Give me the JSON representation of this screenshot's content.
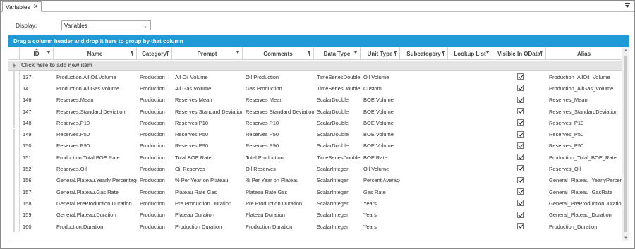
{
  "tab": {
    "title": "Variables",
    "close_glyph": "✕"
  },
  "display": {
    "label": "Display:",
    "value": "Variables"
  },
  "grid": {
    "group_panel": "Drag a column header and drop it here to group by that column",
    "add_row": "Click here to add new item",
    "columns": [
      "ID",
      "Name",
      "Category",
      "Prompt",
      "Comments",
      "Data Type",
      "Unit Type",
      "Subcategory",
      "Lookup List",
      "Visible In OData",
      "Alias"
    ],
    "rows": [
      [
        "137",
        "Production.All Oil.Volume",
        "Production",
        "All Oil Volume",
        "Oil Production",
        "TimeSeriesDouble",
        "Oil Volume",
        "",
        "",
        true,
        "Production_AllOil_Volume"
      ],
      [
        "141",
        "Production.All Gas.Volume",
        "Production",
        "All Gas Volume",
        "Gas Production",
        "TimeSeriesDouble",
        "Custom",
        "",
        "",
        true,
        "Production_AllGas_Volume"
      ],
      [
        "146",
        "Reserves.Mean",
        "Production",
        "Reserves Mean",
        "Reserves Mean",
        "ScalarDouble",
        "BOE Volume",
        "",
        "",
        true,
        "Reserves_Mean"
      ],
      [
        "147",
        "Reserves.Standard Deviation",
        "Production",
        "Reserves Standard Deviation",
        "Reserves Standard Deviation",
        "ScalarDouble",
        "BOE Volume",
        "",
        "",
        true,
        "Reserves_StandardDeviation"
      ],
      [
        "148",
        "Reserves.P10",
        "Production",
        "Reserves P10",
        "Reserves P10",
        "ScalarDouble",
        "BOE Volume",
        "",
        "",
        true,
        "Reserves_P10"
      ],
      [
        "149",
        "Reserves.P50",
        "Production",
        "Reserves P50",
        "Reserves P50",
        "ScalarDouble",
        "BOE Volume",
        "",
        "",
        true,
        "Reserves_P50"
      ],
      [
        "150",
        "Reserves.P90",
        "Production",
        "Reserves P90",
        "Reserves P90",
        "ScalarDouble",
        "BOE Volume",
        "",
        "",
        true,
        "Reserves_P90"
      ],
      [
        "151",
        "Production.Total.BOE.Rate",
        "Production",
        "Total BOE Rate",
        "Total Production",
        "TimeSeriesDouble",
        "BOE Rate",
        "",
        "",
        true,
        "Production_Total_BOE_Rate"
      ],
      [
        "152",
        "Reserves.Oil",
        "Production",
        "Oil Reserves",
        "Oil Reserves",
        "ScalarInteger",
        "Oil Volume",
        "",
        "",
        true,
        "Reserves_Oil"
      ],
      [
        "156",
        "General.Plateau.Yearly Percentage",
        "Production",
        "% Per Year on Plateau",
        "% Per Year on Plateau",
        "ScalarInteger",
        "Percent Average",
        "",
        "",
        true,
        "General_Plateau_YearlyPercentage"
      ],
      [
        "157",
        "General.Plateau.Gas Rate",
        "Production",
        "Plateau Rate Gas",
        "Plateau Rate Gas",
        "ScalarInteger",
        "Gas Rate",
        "",
        "",
        true,
        "General_Plateau_GasRate"
      ],
      [
        "158",
        "General.PreProduction Duration",
        "Production",
        "Pre Production Duration",
        "Pre Production Duration",
        "ScalarInteger",
        "Years",
        "",
        "",
        true,
        "General_PreProductionDuration"
      ],
      [
        "159",
        "General.Plateau.Duration",
        "Production",
        "Plateau Duration",
        "Plateau Duration",
        "ScalarInteger",
        "Years",
        "",
        "",
        true,
        "General_Plateau_Duration"
      ],
      [
        "160",
        "Production.Duration",
        "Production",
        "Production Duration",
        "Production Duration",
        "ScalarInteger",
        "Years",
        "",
        "",
        true,
        "Production_Duration"
      ]
    ]
  },
  "icons": {
    "tab_menu": "dropdown-menu-icon",
    "filter": "filter-funnel-icon",
    "sort": "sort-ascending-icon",
    "add": "plus-icon",
    "checkbox": "checkbox-checked-icon"
  },
  "colors": {
    "group_panel": "#1f9ad6",
    "add_row_bg": "#e4e4e4"
  }
}
